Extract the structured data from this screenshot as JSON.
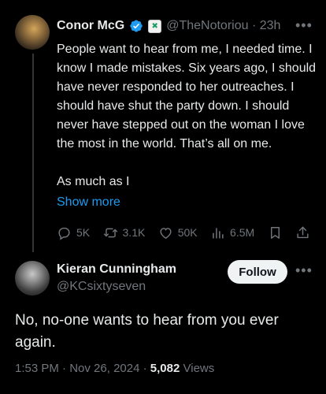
{
  "tweet": {
    "author_name": "Conor McG",
    "handle": "@TheNotoriou",
    "time_ago": "23h",
    "affiliate_badge_glyph": "✖",
    "text": "People want to hear from me, I needed time. I know I made mistakes. Six years ago, I should have never responded to her outreaches. I should have shut the party down. I should never have stepped out on the woman I love the most in the world. That’s all on me.\n\nAs much as I",
    "show_more": "Show more",
    "stats": {
      "replies": "5K",
      "retweets": "3.1K",
      "likes": "50K",
      "views": "6.5M"
    }
  },
  "reply": {
    "author_name": "Kieran Cunningham",
    "handle": "@KCsixtyseven",
    "follow_label": "Follow",
    "text": "No, no-one wants to hear from you ever again.",
    "time": "1:53 PM",
    "date": "Nov 26, 2024",
    "views_count": "5,082",
    "views_label": "Views"
  },
  "icons": {
    "verified": "verified-badge-icon",
    "affiliate": "affiliate-badge-icon",
    "more": "more-dots-icon",
    "reply": "reply-icon",
    "retweet": "retweet-icon",
    "like": "like-icon",
    "views": "views-icon",
    "bookmark": "bookmark-icon",
    "share": "share-icon"
  },
  "colors": {
    "background": "#000000",
    "text": "#e7e9ea",
    "muted": "#71767b",
    "link": "#1d9bf0"
  }
}
